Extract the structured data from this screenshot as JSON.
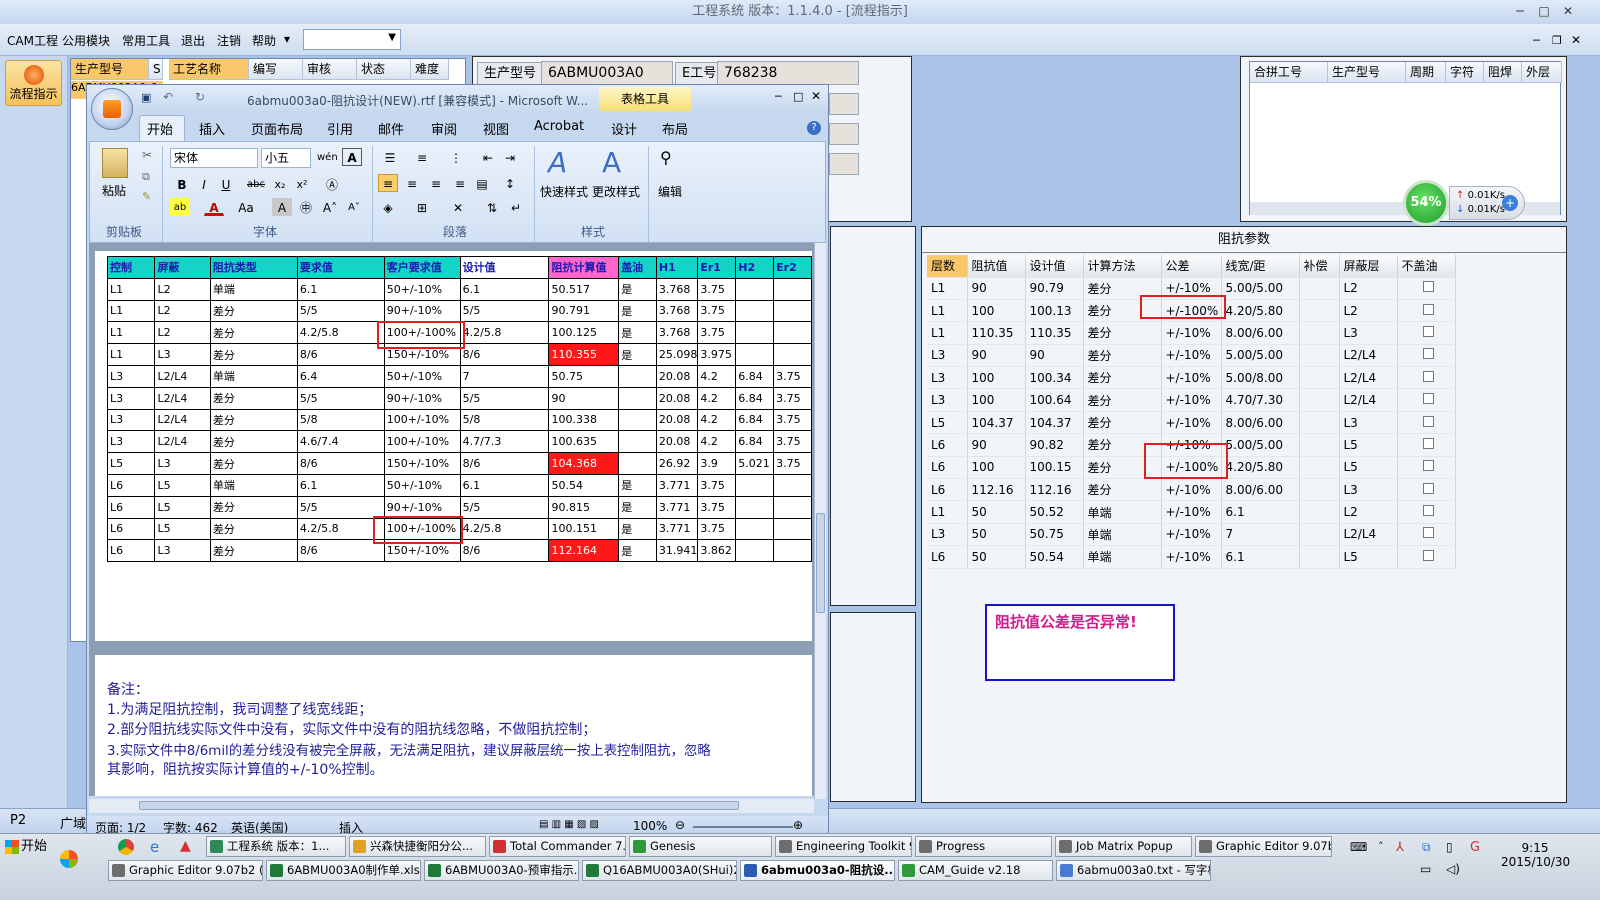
{
  "app": {
    "title": "工程系统   版本：1.1.4.0 - [流程指示]",
    "menu": [
      "CAM工程",
      "公用模块",
      "常用工具",
      "退出",
      "注销",
      "帮助"
    ],
    "menu_dropdown_arrow": "▾",
    "flow_button": "流程指示",
    "left_grid_headers": [
      "生产型号",
      "S"
    ],
    "left_grid_row1": "6ABMU003A0-6",
    "process_headers": [
      "工艺名称",
      "编写",
      "审核",
      "状态",
      "难度"
    ],
    "prod_label": "生产型号",
    "prod_value": "6ABMU003A0",
    "eng_label": "E工号",
    "eng_value": "768238",
    "merge_headers": [
      "合拼工号",
      "生产型号",
      "周期",
      "字符",
      "阻焊",
      "外层"
    ],
    "status_left": "P2",
    "status_left2": "广域"
  },
  "network_widget": {
    "percent": "54%",
    "up": "0.01K/s",
    "down": "0.01K/s"
  },
  "impedance": {
    "title": "阻抗参数",
    "headers": [
      "层数",
      "阻抗值",
      "设计值",
      "计算方法",
      "公差",
      "线宽/距",
      "补偿",
      "屏蔽层",
      "不盖油"
    ],
    "rows": [
      [
        "L1",
        "90",
        "90.79",
        "差分",
        "+/-10%",
        "5.00/5.00",
        "",
        "L2"
      ],
      [
        "L1",
        "100",
        "100.13",
        "差分",
        "+/-100%",
        "4.20/5.80",
        "",
        "L2"
      ],
      [
        "L1",
        "110.35",
        "110.35",
        "差分",
        "+/-10%",
        "8.00/6.00",
        "",
        "L3"
      ],
      [
        "L3",
        "90",
        "90",
        "差分",
        "+/-10%",
        "5.00/5.00",
        "",
        "L2/L4"
      ],
      [
        "L3",
        "100",
        "100.34",
        "差分",
        "+/-10%",
        "5.00/8.00",
        "",
        "L2/L4"
      ],
      [
        "L3",
        "100",
        "100.64",
        "差分",
        "+/-10%",
        "4.70/7.30",
        "",
        "L2/L4"
      ],
      [
        "L5",
        "104.37",
        "104.37",
        "差分",
        "+/-10%",
        "8.00/6.00",
        "",
        "L3"
      ],
      [
        "L6",
        "90",
        "90.82",
        "差分",
        "+/-10%",
        "5.00/5.00",
        "",
        "L5"
      ],
      [
        "L6",
        "100",
        "100.15",
        "差分",
        "+/-100%",
        "4.20/5.80",
        "",
        "L5"
      ],
      [
        "L6",
        "112.16",
        "112.16",
        "差分",
        "+/-10%",
        "8.00/6.00",
        "",
        "L3"
      ],
      [
        "L1",
        "50",
        "50.52",
        "单端",
        "+/-10%",
        "6.1",
        "",
        "L2"
      ],
      [
        "L3",
        "50",
        "50.75",
        "单端",
        "+/-10%",
        "7",
        "",
        "L2/L4"
      ],
      [
        "L6",
        "50",
        "50.54",
        "单端",
        "+/-10%",
        "6.1",
        "",
        "L5"
      ]
    ]
  },
  "alert": "阻抗值公差是否异常!",
  "word": {
    "title": "6abmu003a0-阻抗设计(NEW).rtf [兼容模式] - Microsoft W...",
    "context_tab": "表格工具",
    "tabs": [
      "开始",
      "插入",
      "页面布局",
      "引用",
      "邮件",
      "审阅",
      "视图",
      "Acrobat",
      "设计",
      "布局"
    ],
    "font_name": "宋体",
    "font_size": "小五",
    "groups": [
      "剪贴板",
      "字体",
      "段落",
      "样式",
      "编辑"
    ],
    "paste": "粘贴",
    "quick_style": "快速样式",
    "change_style": "更改样式",
    "edit": "编辑",
    "table_headers": [
      "控制",
      "屏蔽",
      "阻抗类型",
      "要求值",
      "客户要求值",
      "设计值",
      "阻抗计算值",
      "盖油",
      "H1",
      "Er1",
      "H2",
      "Er2"
    ],
    "table_rows": [
      [
        "L1",
        "L2",
        "单端",
        "6.1",
        "50+/-10%",
        "6.1",
        "50.517",
        "是",
        "3.768",
        "3.75",
        "",
        ""
      ],
      [
        "L1",
        "L2",
        "差分",
        "5/5",
        "90+/-10%",
        "5/5",
        "90.791",
        "是",
        "3.768",
        "3.75",
        "",
        ""
      ],
      [
        "L1",
        "L2",
        "差分",
        "4.2/5.8",
        "100+/-100%",
        "4.2/5.8",
        "100.125",
        "是",
        "3.768",
        "3.75",
        "",
        ""
      ],
      [
        "L1",
        "L3",
        "差分",
        "8/6",
        "150+/-10%",
        "8/6",
        "110.355",
        "是",
        "25.098",
        "3.975",
        "",
        ""
      ],
      [
        "L3",
        "L2/L4",
        "单端",
        "6.4",
        "50+/-10%",
        "7",
        "50.75",
        "",
        "20.08",
        "4.2",
        "6.84",
        "3.75"
      ],
      [
        "L3",
        "L2/L4",
        "差分",
        "5/5",
        "90+/-10%",
        "5/5",
        "90",
        "",
        "20.08",
        "4.2",
        "6.84",
        "3.75"
      ],
      [
        "L3",
        "L2/L4",
        "差分",
        "5/8",
        "100+/-10%",
        "5/8",
        "100.338",
        "",
        "20.08",
        "4.2",
        "6.84",
        "3.75"
      ],
      [
        "L3",
        "L2/L4",
        "差分",
        "4.6/7.4",
        "100+/-10%",
        "4.7/7.3",
        "100.635",
        "",
        "20.08",
        "4.2",
        "6.84",
        "3.75"
      ],
      [
        "L5",
        "L3",
        "差分",
        "8/6",
        "150+/-10%",
        "8/6",
        "104.368",
        "",
        "26.92",
        "3.9",
        "5.021",
        "3.75"
      ],
      [
        "L6",
        "L5",
        "单端",
        "6.1",
        "50+/-10%",
        "6.1",
        "50.54",
        "是",
        "3.771",
        "3.75",
        "",
        ""
      ],
      [
        "L6",
        "L5",
        "差分",
        "5/5",
        "90+/-10%",
        "5/5",
        "90.815",
        "是",
        "3.771",
        "3.75",
        "",
        ""
      ],
      [
        "L6",
        "L5",
        "差分",
        "4.2/5.8",
        "100+/-100%",
        "4.2/5.8",
        "100.151",
        "是",
        "3.771",
        "3.75",
        "",
        ""
      ],
      [
        "L6",
        "L3",
        "差分",
        "8/6",
        "150+/-10%",
        "8/6",
        "112.164",
        "是",
        "31.941",
        "3.862",
        "",
        ""
      ]
    ],
    "notes": [
      "备注：",
      "1.为满足阻抗控制，我司调整了线宽线距；",
      "2.部分阻抗线实际文件中没有，实际文件中没有的阻抗线忽略，不做阻抗控制；",
      "3.实际文件中8/6mil的差分线没有被完全屏蔽，无法满足阻抗，建议屏蔽层统一按上表控制阻抗，忽略",
      "其影响，阻抗按实际计算值的+/-10%控制。"
    ],
    "status_page": "页面: 1/2",
    "status_words": "字数: 462",
    "status_lang": "英语(美国)",
    "status_insert": "插入",
    "zoom": "100%"
  },
  "taskbar": {
    "start": "开始",
    "row1": [
      "工程系统  版本：1...",
      "兴森快捷衡阳分公...",
      "Total Commander 7....",
      "Genesis",
      "Engineering Toolkit 9...",
      "Progress",
      "Job Matrix Popup",
      "Graphic Editor 9.07b..."
    ],
    "row2": [
      "Graphic Editor 9.07b2 (0...",
      "6ABMU003A0制作单.xls...",
      "6ABMU003A0-预审指示...",
      "Q16ABMU003A0(SHui)20...",
      "6abmu003a0-阻抗设...",
      "CAM_Guide v2.18",
      "6abmu003a0.txt - 写字板"
    ],
    "time": "9:15",
    "date": "2015/10/30"
  }
}
